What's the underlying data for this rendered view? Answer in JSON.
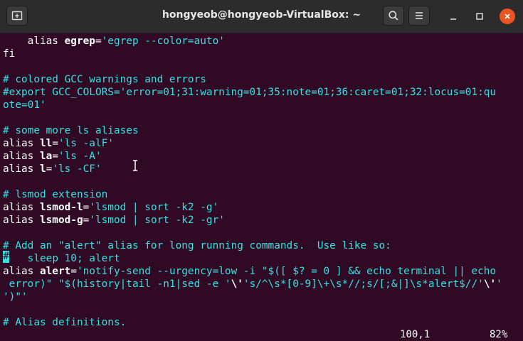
{
  "window": {
    "title": "hongyeob@hongyeob-VirtualBox: ~",
    "buttons": {
      "new_tab": "new-tab-icon",
      "search": "search-icon",
      "menu": "hamburger-menu-icon",
      "minimize": "minimize-icon",
      "maximize": "maximize-icon",
      "close": "close-icon"
    },
    "accent": "#e95420"
  },
  "terminal": {
    "background": "#300a24",
    "lines": [
      {
        "segs": [
          [
            "w",
            "    alias "
          ],
          [
            "b",
            "egrep"
          ],
          [
            "w",
            "="
          ],
          [
            "c",
            "'egrep --color=auto'"
          ]
        ]
      },
      {
        "segs": [
          [
            "w",
            "fi"
          ]
        ]
      },
      {
        "segs": []
      },
      {
        "segs": [
          [
            "c",
            "# colored GCC warnings and errors"
          ]
        ]
      },
      {
        "segs": [
          [
            "c",
            "#export GCC_COLORS='error=01;31:warning=01;35:note=01;36:caret=01;32:locus=01:qu"
          ]
        ]
      },
      {
        "segs": [
          [
            "c",
            "ote=01'"
          ]
        ]
      },
      {
        "segs": []
      },
      {
        "segs": [
          [
            "c",
            "# some more ls aliases"
          ]
        ]
      },
      {
        "segs": [
          [
            "w",
            "alias "
          ],
          [
            "b",
            "ll"
          ],
          [
            "w",
            "="
          ],
          [
            "c",
            "'ls -alF'"
          ]
        ]
      },
      {
        "segs": [
          [
            "w",
            "alias "
          ],
          [
            "b",
            "la"
          ],
          [
            "w",
            "="
          ],
          [
            "c",
            "'ls -A'"
          ]
        ]
      },
      {
        "segs": [
          [
            "w",
            "alias "
          ],
          [
            "b",
            "l"
          ],
          [
            "w",
            "="
          ],
          [
            "c",
            "'ls -CF'"
          ]
        ]
      },
      {
        "segs": []
      },
      {
        "segs": [
          [
            "c",
            "# lsmod extension"
          ]
        ]
      },
      {
        "segs": [
          [
            "w",
            "alias "
          ],
          [
            "b",
            "lsmod-l"
          ],
          [
            "w",
            "="
          ],
          [
            "c",
            "'lsmod | sort -k2 -g'"
          ]
        ]
      },
      {
        "segs": [
          [
            "w",
            "alias "
          ],
          [
            "b",
            "lsmod-g"
          ],
          [
            "w",
            "="
          ],
          [
            "c",
            "'lsmod | sort -k2 -gr'"
          ]
        ]
      },
      {
        "segs": []
      },
      {
        "segs": [
          [
            "c",
            "# Add an \"alert\" alias for long running commands.  Use like so:"
          ]
        ]
      },
      {
        "segs": [
          [
            "c",
            " "
          ],
          [
            "c",
            "   sleep 10; alert"
          ]
        ]
      },
      {
        "segs": [
          [
            "w",
            "alias "
          ],
          [
            "b",
            "alert"
          ],
          [
            "w",
            "="
          ],
          [
            "c",
            "'notify-send --urgency=low -i \"$([ $? = 0 ] && echo terminal || echo"
          ]
        ]
      },
      {
        "segs": [
          [
            "c",
            " error)\" \"$(history|tail -n1|sed -e '"
          ],
          [
            "b",
            "\\'"
          ],
          [
            "c",
            "'s/^\\s*[0-9]\\+\\s*//;s/[;&|]\\s*alert$//'"
          ],
          [
            "b",
            "\\'"
          ],
          [
            "c",
            "'"
          ]
        ]
      },
      {
        "segs": [
          [
            "c",
            "')\"'"
          ]
        ]
      },
      {
        "segs": []
      },
      {
        "segs": [
          [
            "c",
            "# Alias definitions."
          ]
        ]
      }
    ],
    "cursor_char": "#",
    "status_position": "100,1",
    "status_percent": "82%"
  }
}
